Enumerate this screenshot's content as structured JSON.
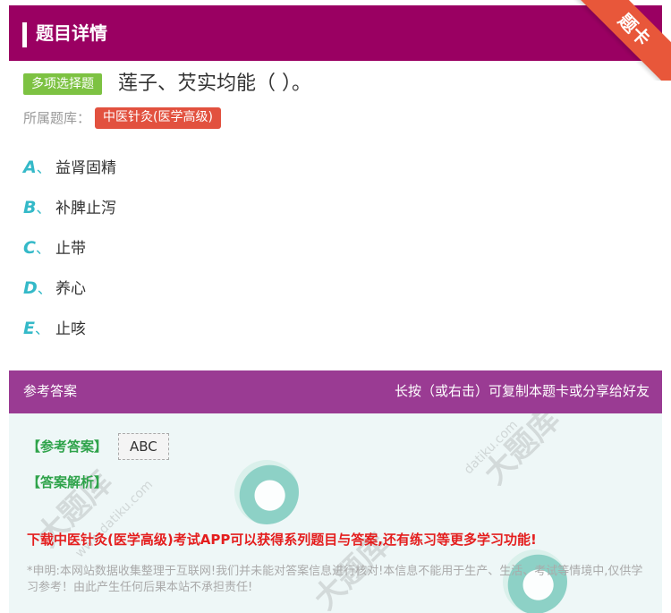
{
  "header": {
    "title": "题目详情",
    "ribbon": "题卡"
  },
  "question": {
    "type_tag": "多项选择题",
    "title": "莲子、芡实均能（ ）。",
    "bank_label": "所属题库：",
    "bank_name": "中医针灸(医学高级)"
  },
  "options": [
    {
      "letter": "A",
      "sep": "、",
      "text": "益肾固精"
    },
    {
      "letter": "B",
      "sep": "、",
      "text": "补脾止泻"
    },
    {
      "letter": "C",
      "sep": "、",
      "text": "止带"
    },
    {
      "letter": "D",
      "sep": "、",
      "text": "养心"
    },
    {
      "letter": "E",
      "sep": "、",
      "text": "止咳"
    }
  ],
  "answer": {
    "section_title": "参考答案",
    "share_hint": "长按（或右击）可复制本题卡或分享给好友",
    "answer_label": "【参考答案】",
    "answer_value": "ABC",
    "analysis_label": "【答案解析】",
    "promo": "下载中医针灸(医学高级)考试APP可以获得系列题目与答案,还有练习等更多学习功能!",
    "disclaimer": "*申明:本网站数据收集整理于互联网!我们并未能对答案信息进行核对!本信息不能用于生产、生活、考试等情境中,仅供学习参考！由此产生任何后果本站不承担责任!"
  },
  "colors": {
    "header_bg": "#9a0062",
    "ribbon": "#e8573a",
    "type_tag": "#7dc242",
    "bank_tag": "#e2513f",
    "option_letter": "#34b9c8",
    "answer_header": "#9a3b93",
    "answer_label": "#2ea34a",
    "promo": "#e41e1e"
  }
}
